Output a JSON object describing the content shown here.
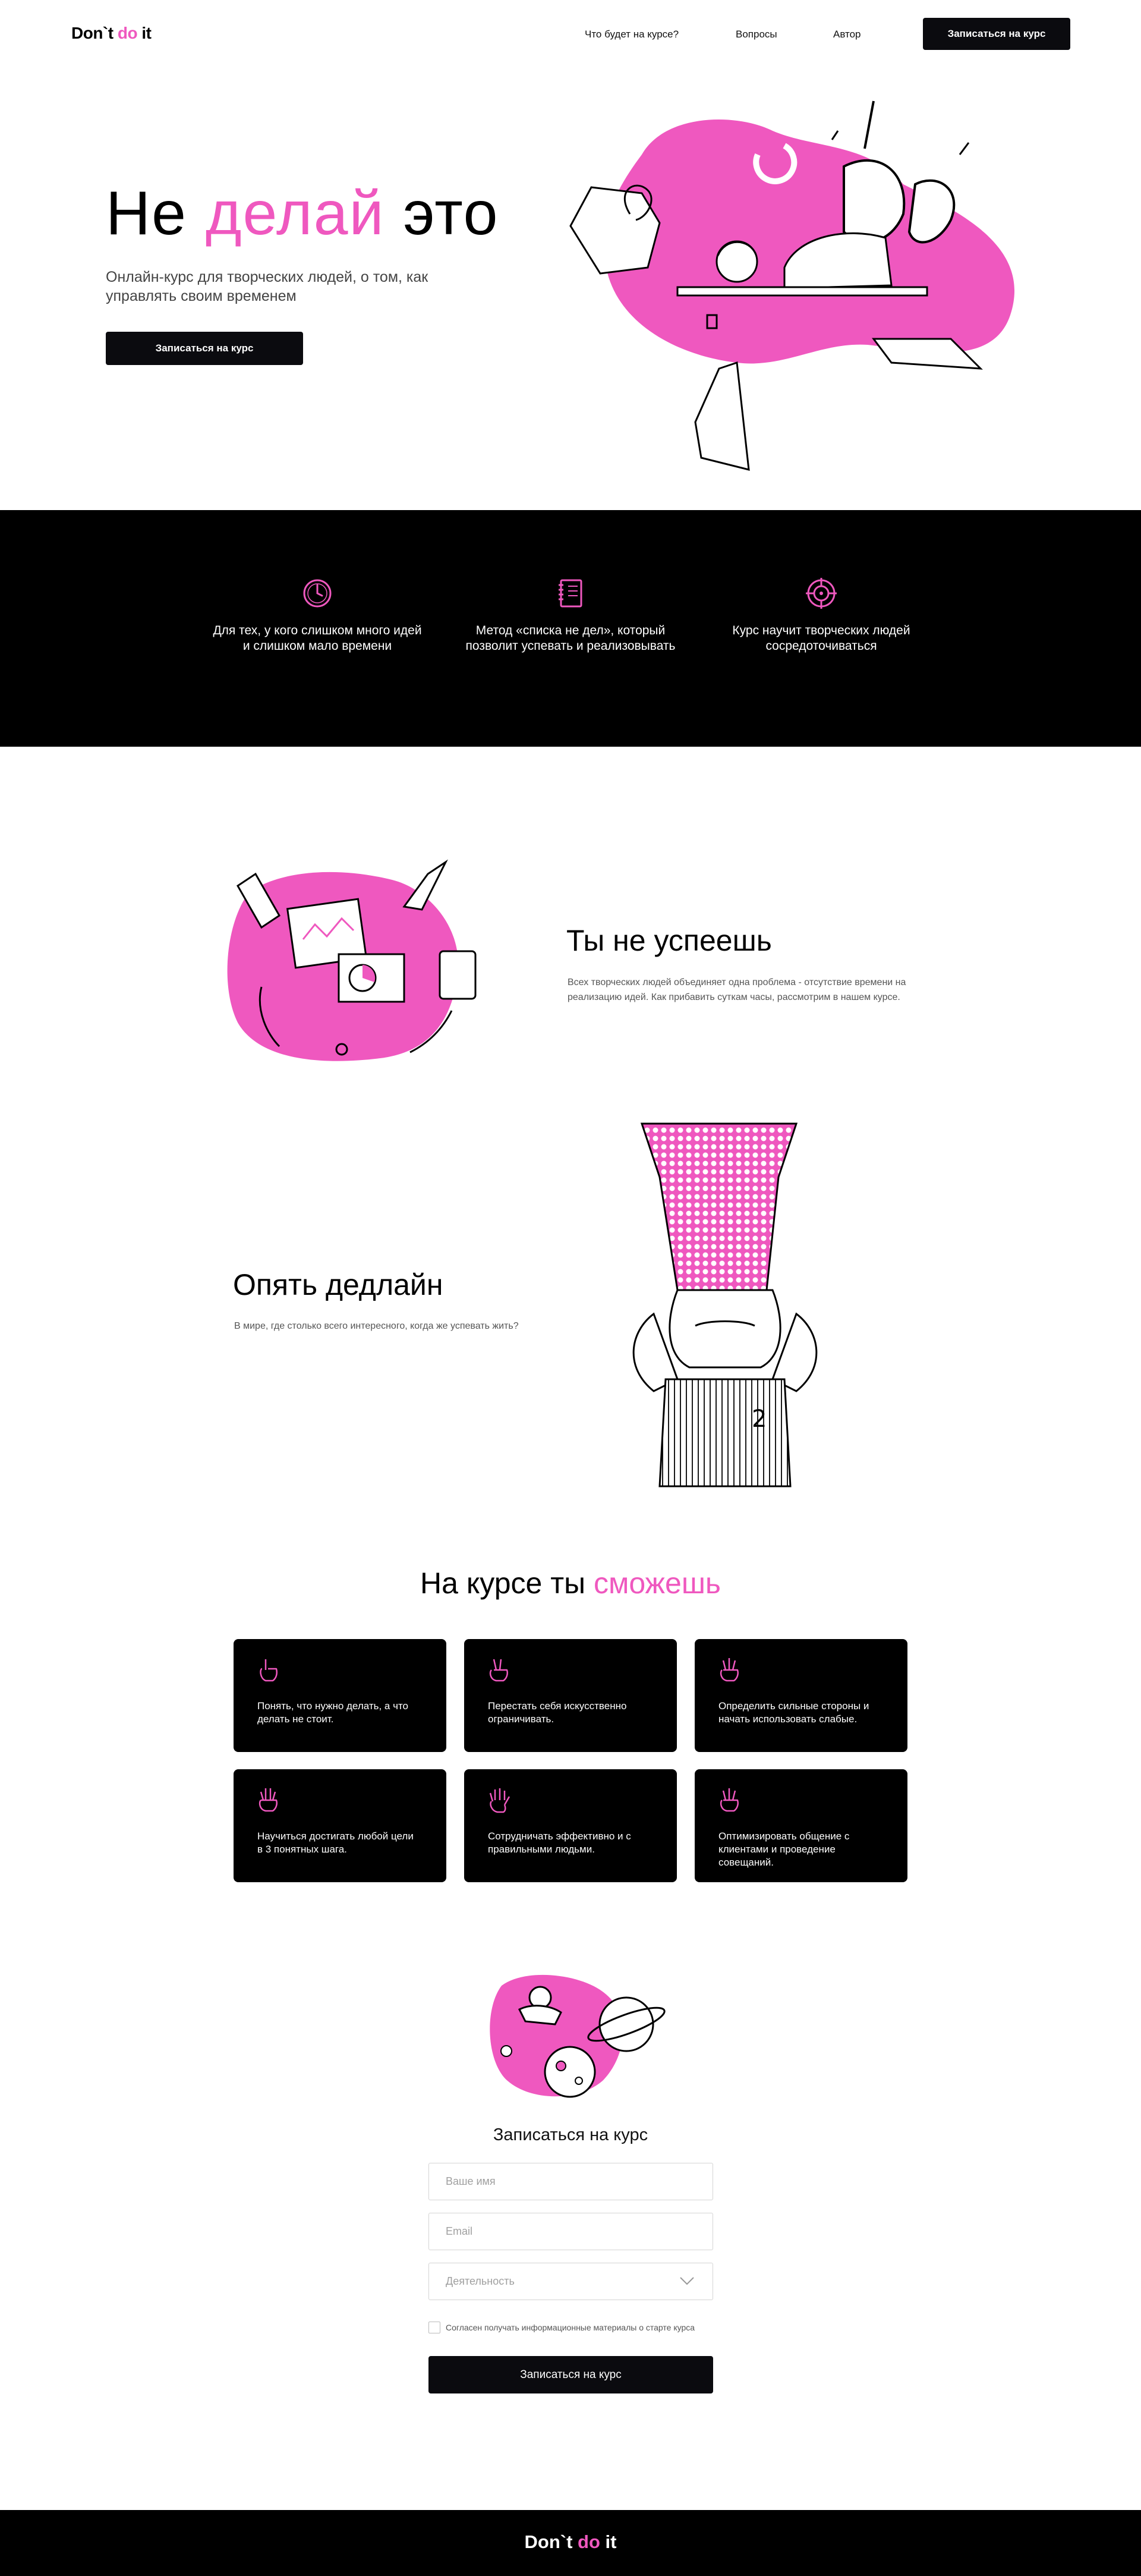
{
  "header": {
    "logo": {
      "part1": "Don`t ",
      "part2": "do",
      "part3": " it"
    },
    "nav": [
      "Что будет на курсе?",
      "Вопросы",
      "Автор"
    ],
    "cta": "Записаться на курс"
  },
  "hero": {
    "title": {
      "word1": "Не ",
      "word2": "делай",
      "word3": " это"
    },
    "subtitle": "Онлайн-курс для творческих людей, о том, как управлять своим временем",
    "cta": "Записаться на курс"
  },
  "features": [
    {
      "icon": "clock-icon",
      "text": "Для тех, у кого слишком много идей и слишком мало времени"
    },
    {
      "icon": "notebook-icon",
      "text": "Метод «списка не дел», который позволит успевать и реализовывать"
    },
    {
      "icon": "target-icon",
      "text": "Курс научит творческих людей сосредоточиваться"
    }
  ],
  "section1": {
    "title": "Ты не успеешь",
    "text": "Всех творческих людей объединяет одна проблема - отсутствие времени на реализацию идей. Как прибавить суткам часы, рассмотрим в нашем курсе."
  },
  "section2": {
    "title": "Опять дедлайн",
    "text": "В мире, где столько всего интересного, когда же успевать жить?"
  },
  "skills": {
    "title": {
      "part1": "На курсе ты ",
      "part2": "сможешь"
    },
    "cards": [
      {
        "icon": "one-finger-hand-icon",
        "text": "Понять, что нужно делать, а что делать не стоит."
      },
      {
        "icon": "two-fingers-hand-icon",
        "text": "Перестать себя искусственно ограничивать."
      },
      {
        "icon": "three-fingers-hand-icon",
        "text": "Определить сильные стороны и начать использовать слабые."
      },
      {
        "icon": "four-fingers-hand-icon",
        "text": "Научиться достигать любой цели в 3 понятных шага."
      },
      {
        "icon": "open-palm-icon",
        "text": "Сотрудничать эффективно и с правильными людьми."
      },
      {
        "icon": "three-fingers-hand-icon",
        "text": "Оптимизировать общение с клиентами и проведение совещаний."
      }
    ]
  },
  "form": {
    "title": "Записаться на курс",
    "name_placeholder": "Ваше имя",
    "email_placeholder": "Email",
    "activity_placeholder": "Деятельность",
    "consent": "Согласен получать информационные материалы о старте курса",
    "submit": "Записаться на курс"
  },
  "footer": {
    "logo": {
      "part1": "Don`t ",
      "part2": "do",
      "part3": " it"
    }
  },
  "colors": {
    "accent": "#EF58BF",
    "dark": "#000000",
    "text_muted": "#555555"
  }
}
